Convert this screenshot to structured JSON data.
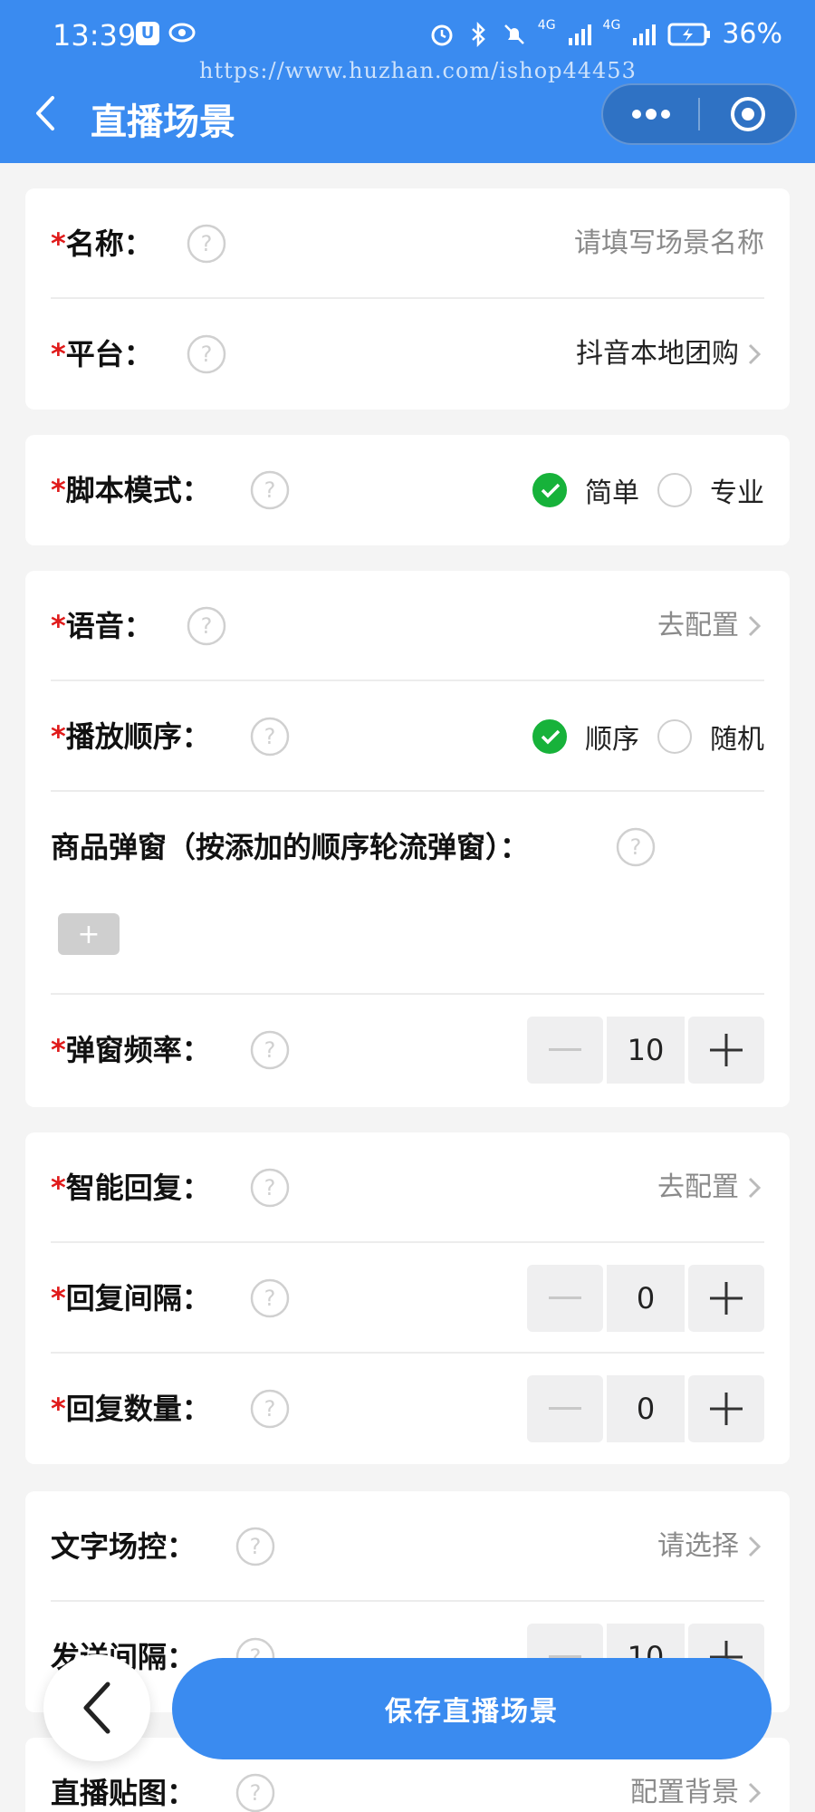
{
  "status": {
    "time": "13:39",
    "app_icon_glyph": "U",
    "network1": "4G",
    "network2": "4G",
    "battery": "36%"
  },
  "watermark": "https://www.huzhan.com/ishop44453",
  "header": {
    "title": "直播场景"
  },
  "colors": {
    "primary": "#3a8bf0",
    "required": "#e01b1b",
    "check": "#17b23a"
  },
  "fields": {
    "name": {
      "required": "*",
      "label": "名称：",
      "placeholder": "请填写场景名称"
    },
    "platform": {
      "required": "*",
      "label": "平台：",
      "value": "抖音本地团购"
    },
    "script_mode": {
      "required": "*",
      "label": "脚本模式：",
      "options": [
        "简单",
        "专业"
      ],
      "selected": "简单"
    },
    "voice": {
      "required": "*",
      "label": "语音：",
      "action": "去配置"
    },
    "play_order": {
      "required": "*",
      "label": "播放顺序：",
      "options": [
        "顺序",
        "随机"
      ],
      "selected": "顺序"
    },
    "product_popup": {
      "label": "商品弹窗（按添加的顺序轮流弹窗）：",
      "add_label": "+"
    },
    "popup_freq": {
      "required": "*",
      "label": "弹窗频率：",
      "value": "10"
    },
    "smart_reply": {
      "required": "*",
      "label": "智能回复：",
      "action": "去配置"
    },
    "reply_interval": {
      "required": "*",
      "label": "回复间隔：",
      "value": "0"
    },
    "reply_count": {
      "required": "*",
      "label": "回复数量：",
      "value": "0"
    },
    "text_control": {
      "label": "文字场控：",
      "action": "请选择"
    },
    "send_interval": {
      "label": "发送间隔：",
      "value": "10"
    },
    "sticker": {
      "label": "直播贴图：",
      "action": "配置背景"
    }
  },
  "footer": {
    "save_label": "保存直播场景"
  }
}
